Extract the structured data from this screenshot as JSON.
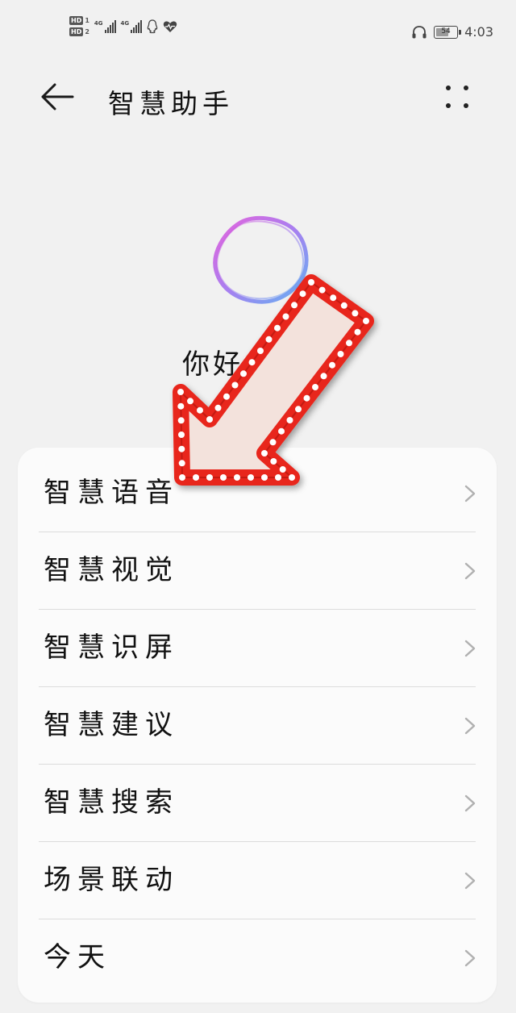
{
  "status_bar": {
    "sim1_label": "HD",
    "sim1_num": "1",
    "sim2_label": "HD",
    "sim2_num": "2",
    "net1": "4G",
    "net2": "4G",
    "battery_level": "54",
    "time": "4:03"
  },
  "header": {
    "title": "智慧助手"
  },
  "hero": {
    "greeting": "你好"
  },
  "menu": {
    "items": [
      {
        "label": "智慧语音"
      },
      {
        "label": "智慧视觉"
      },
      {
        "label": "智慧识屏"
      },
      {
        "label": "智慧建议"
      },
      {
        "label": "智慧搜索"
      },
      {
        "label": "场景联动"
      },
      {
        "label": "今天"
      }
    ]
  },
  "colors": {
    "background": "#f1f1f1",
    "card": "#fbfbfb",
    "arrow_red": "#e8281f",
    "arrow_fill": "#f3e2dc"
  }
}
